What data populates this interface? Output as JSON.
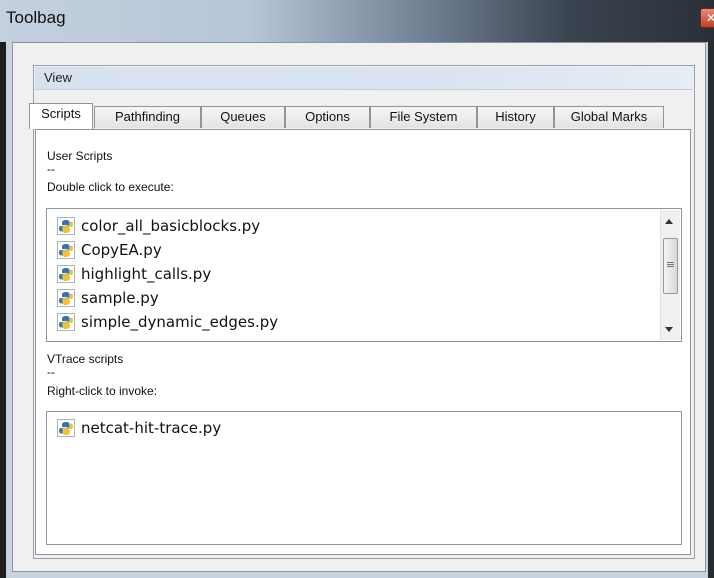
{
  "window": {
    "title": "Toolbag",
    "close_icon": "close-icon"
  },
  "view": {
    "label": "View"
  },
  "tabs": [
    {
      "label": "Scripts",
      "active": true
    },
    {
      "label": "Pathfinding",
      "active": false
    },
    {
      "label": "Queues",
      "active": false
    },
    {
      "label": "Options",
      "active": false
    },
    {
      "label": "File System",
      "active": false
    },
    {
      "label": "History",
      "active": false
    },
    {
      "label": "Global Marks",
      "active": false
    }
  ],
  "user_scripts": {
    "heading": "User Scripts",
    "separator": "--",
    "instruction": "Double click to execute:",
    "items": [
      "color_all_basicblocks.py",
      "CopyEA.py",
      "highlight_calls.py",
      "sample.py",
      "simple_dynamic_edges.py"
    ]
  },
  "vtrace_scripts": {
    "heading": "VTrace scripts",
    "separator": "--",
    "instruction": "Right-click to invoke:",
    "items": [
      "netcat-hit-trace.py"
    ]
  },
  "colors": {
    "python_blue": "#3a74b0",
    "python_yellow": "#f2c233",
    "view_header": "#d9e3f1"
  }
}
